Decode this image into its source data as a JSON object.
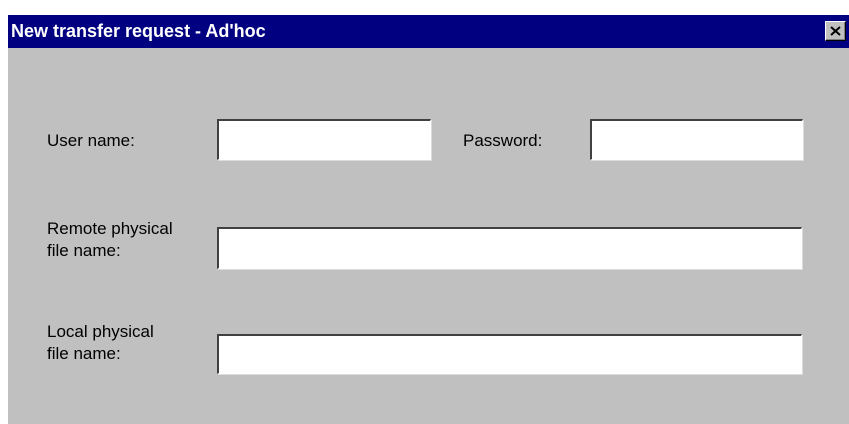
{
  "window": {
    "title": "New transfer request - Ad'hoc",
    "title_bar_color": "#000080",
    "background_color": "#c0c0c0"
  },
  "form": {
    "username_label": "User name:",
    "username_value": "",
    "password_label": "Password:",
    "password_value": "",
    "remote_label_line1": "Remote physical",
    "remote_label_line2": "file name:",
    "remote_value": "",
    "local_label_line1": "Local physical",
    "local_label_line2": "file name:",
    "local_value": ""
  },
  "icons": {
    "close": "close-icon"
  }
}
